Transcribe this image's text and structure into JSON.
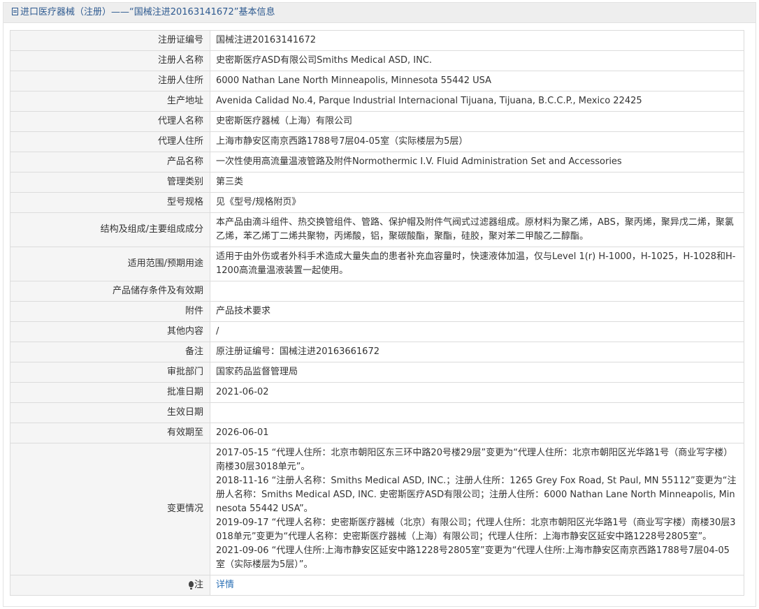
{
  "header": {
    "title": "进口医疗器械（注册）——“国械注进20163141672”基本信息",
    "icon": "document-icon"
  },
  "fields": [
    {
      "label": "注册证编号",
      "value": "国械注进20163141672"
    },
    {
      "label": "注册人名称",
      "value": "史密斯医疗ASD有限公司Smiths Medical ASD, INC."
    },
    {
      "label": "注册人住所",
      "value": "6000 Nathan Lane North Minneapolis, Minnesota 55442 USA"
    },
    {
      "label": "生产地址",
      "value": "Avenida Calidad No.4, Parque Industrial Internacional Tijuana, Tijuana, B.C.C.P., Mexico 22425"
    },
    {
      "label": "代理人名称",
      "value": "史密斯医疗器械（上海）有限公司"
    },
    {
      "label": "代理人住所",
      "value": "上海市静安区南京西路1788号7层04-05室（实际楼层为5层）"
    },
    {
      "label": "产品名称",
      "value": "一次性使用高流量温液管路及附件Normothermic I.V. Fluid Administration Set and Accessories"
    },
    {
      "label": "管理类别",
      "value": "第三类"
    },
    {
      "label": "型号规格",
      "value": "见《型号/规格附页》"
    },
    {
      "label": "结构及组成/主要组成成分",
      "value": "本产品由滴斗组件、热交换管组件、管路、保护帽及附件气阀式过滤器组成。原材料为聚乙烯，ABS，聚丙烯，聚异戊二烯，聚氯乙烯，苯乙烯丁二烯共聚物，丙烯酸，铝，聚碳酸酯，聚酯，硅胶，聚对苯二甲酸乙二醇酯。"
    },
    {
      "label": "适用范围/预期用途",
      "value": "适用于由外伤或者外科手术造成大量失血的患者补充血容量时，快速液体加温，仅与Level 1(r) H-1000，H-1025，H-1028和H-1200高流量温液装置一起使用。"
    },
    {
      "label": "产品储存条件及有效期",
      "value": ""
    },
    {
      "label": "附件",
      "value": "产品技术要求"
    },
    {
      "label": "其他内容",
      "value": "/"
    },
    {
      "label": "备注",
      "value": "原注册证编号：国械注进20163661672"
    },
    {
      "label": "审批部门",
      "value": "国家药品监督管理局"
    },
    {
      "label": "批准日期",
      "value": "2021-06-02"
    },
    {
      "label": "生效日期",
      "value": ""
    },
    {
      "label": "有效期至",
      "value": "2026-06-01"
    }
  ],
  "changes": {
    "label": "变更情况",
    "entries": [
      "2017-05-15 “代理人住所：北京市朝阳区东三环中路20号楼29层”变更为“代理人住所：北京市朝阳区光华路1号（商业写字楼）南楼30层3018单元”。",
      "2018-11-16 “注册人名称：Smiths Medical ASD, INC.；注册人住所：1265 Grey Fox Road, St Paul, MN 55112”变更为“注册人名称：Smiths Medical ASD, INC. 史密斯医疗ASD有限公司；注册人住所：6000 Nathan Lane North Minneapolis, Minnesota 55442 USA”。",
      "2019-09-17 “代理人名称：史密斯医疗器械（北京）有限公司；代理人住所：北京市朝阳区光华路1号（商业写字楼）南楼30层3018单元”变更为“代理人名称：史密斯医疗器械（上海）有限公司；代理人住所：上海市静安区延安中路1228号2805室”。",
      "2021-09-06 “代理人住所:上海市静安区延安中路1228号2805室”变更为“代理人住所:上海市静安区南京西路1788号7层04-05室（实际楼层为5层）”。"
    ]
  },
  "note": {
    "label": "注",
    "icon": "lightbulb-icon",
    "link_text": "详情"
  },
  "colors": {
    "header_text": "#2e5a90",
    "label_bg": "#f5f5f5",
    "border": "#dcdcdc",
    "link": "#2a6fb5"
  }
}
